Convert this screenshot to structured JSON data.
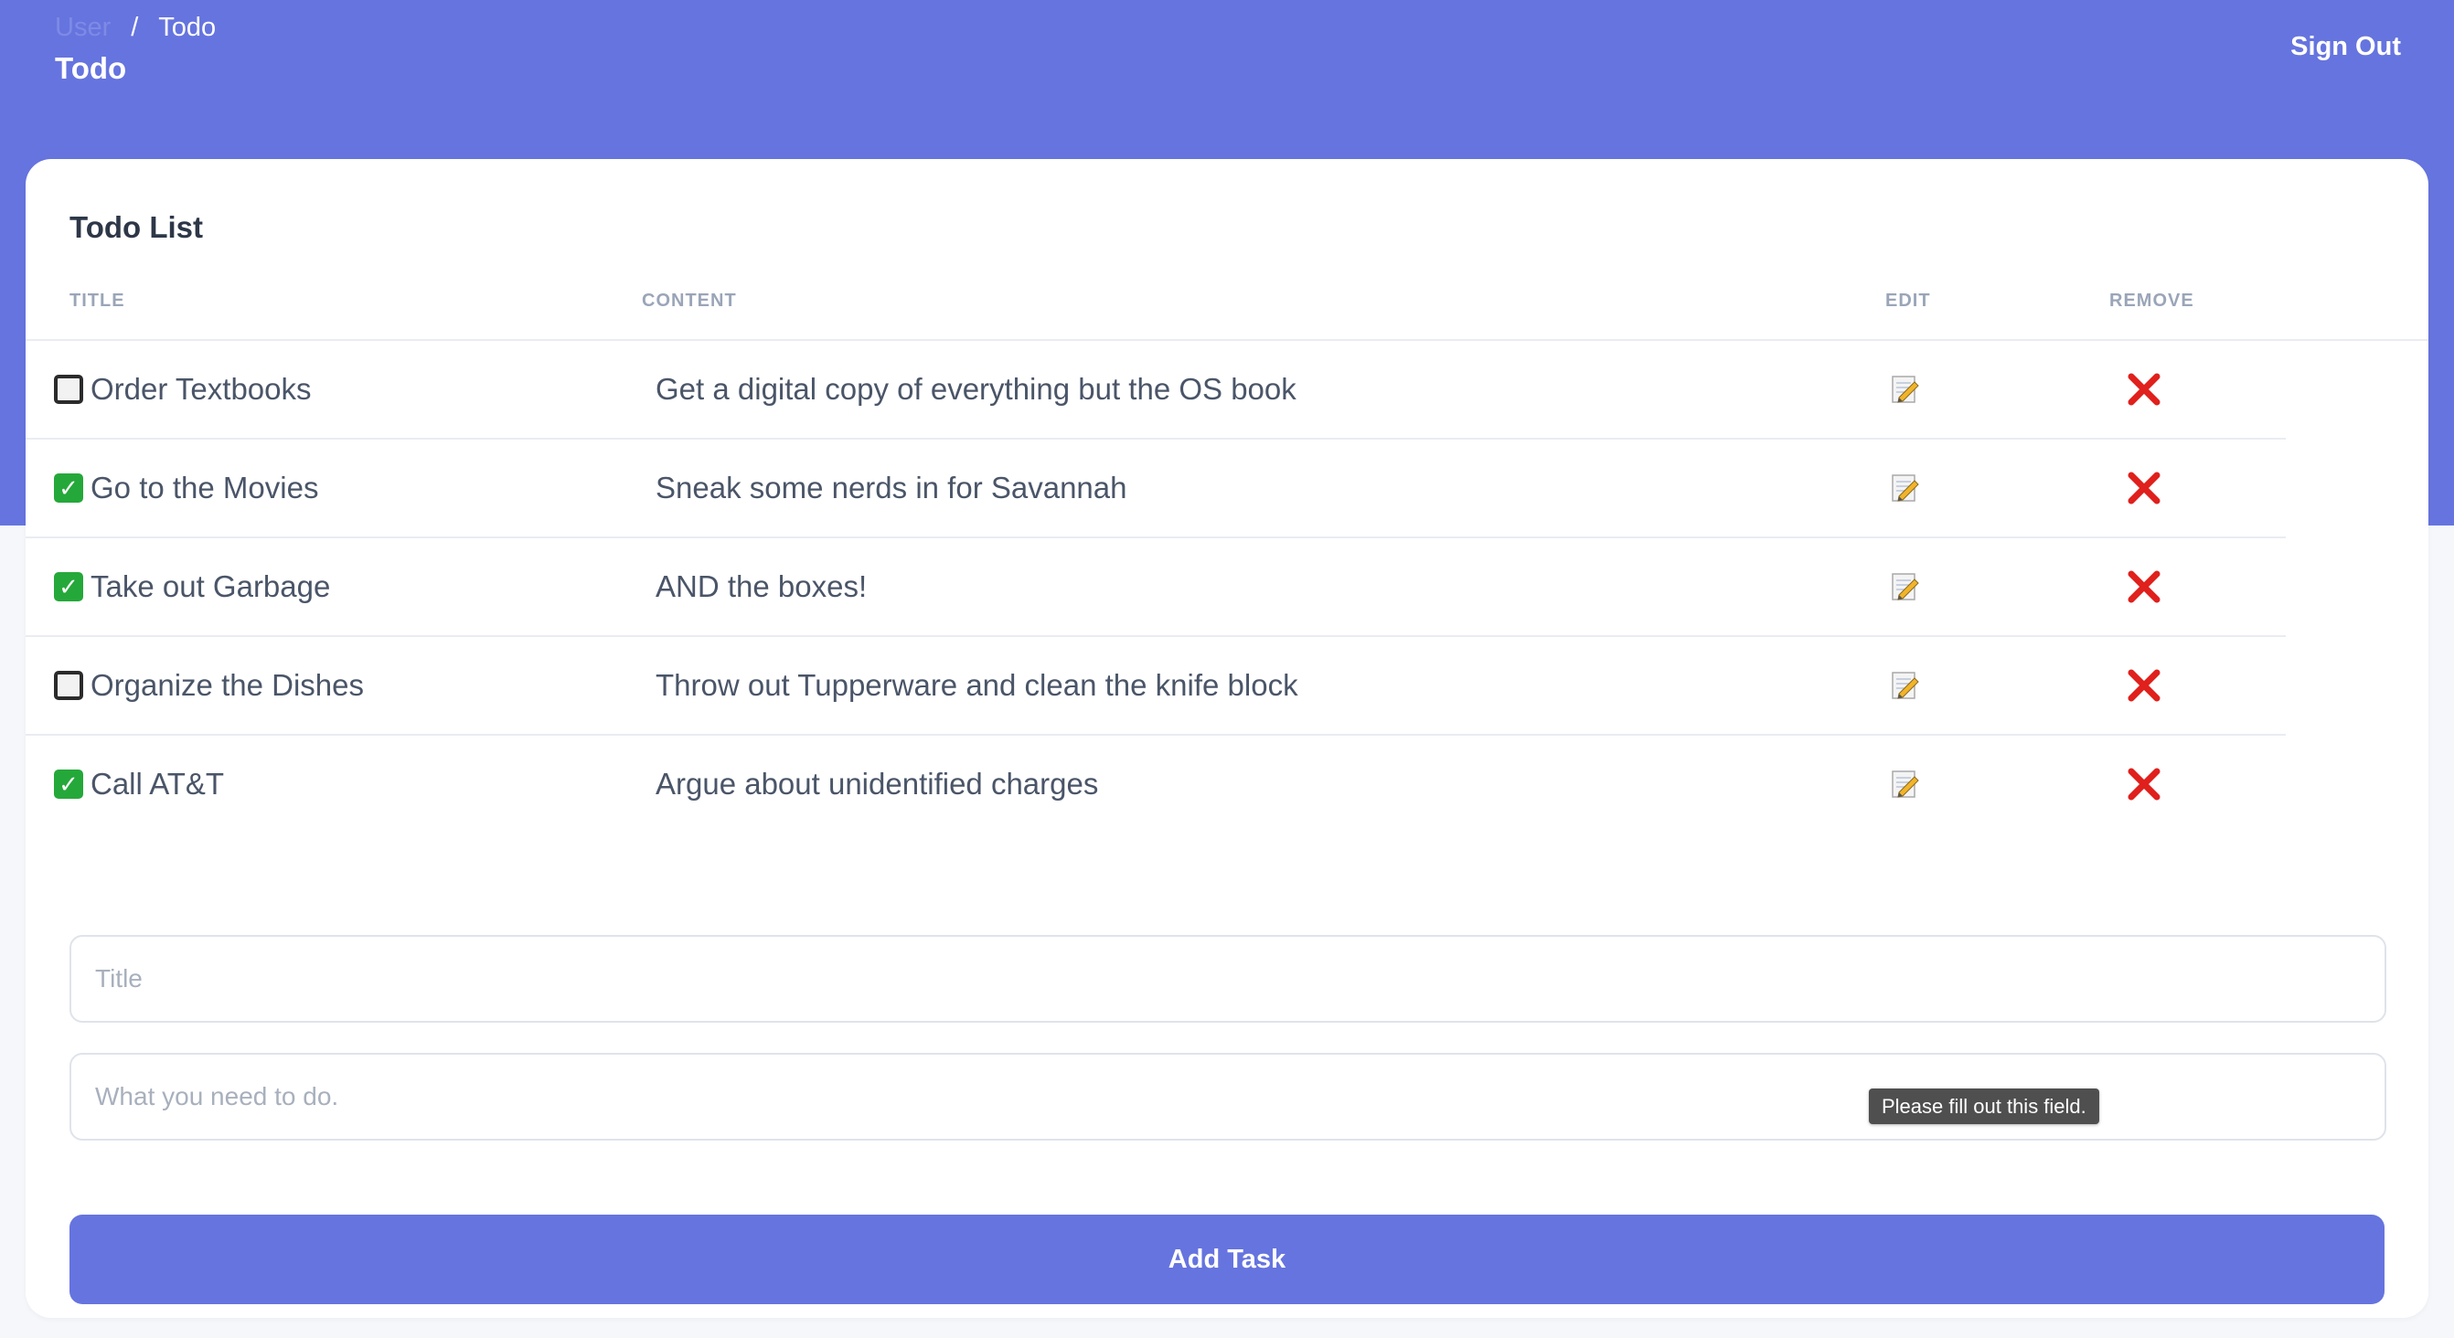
{
  "breadcrumb": {
    "home": "User",
    "separator": "/",
    "current": "Todo"
  },
  "header": {
    "title": "Todo",
    "sign_out": "Sign Out"
  },
  "card": {
    "title": "Todo List"
  },
  "columns": {
    "title": "TITLE",
    "content": "CONTENT",
    "edit": "EDIT",
    "remove": "REMOVE"
  },
  "todos": [
    {
      "title": "Order Textbooks",
      "content": "Get a digital copy of everything but the OS book",
      "done": false
    },
    {
      "title": "Go to the Movies",
      "content": "Sneak some nerds in for Savannah",
      "done": true
    },
    {
      "title": "Take out Garbage",
      "content": "AND the boxes!",
      "done": true
    },
    {
      "title": "Organize the Dishes",
      "content": "Throw out Tupperware and clean the knife block",
      "done": false
    },
    {
      "title": "Call AT&T",
      "content": "Argue about unidentified charges",
      "done": true
    }
  ],
  "form": {
    "title_placeholder": "Title",
    "title_value": "",
    "content_placeholder": "What you need to do.",
    "content_value": "",
    "validation_tooltip": "Please fill out this field.",
    "submit_label": "Add Task"
  },
  "icons": {
    "checked": "check-mark-button-icon",
    "unchecked": "black-square-button-icon",
    "edit": "memo-pencil-icon",
    "remove": "cross-mark-icon"
  },
  "colors": {
    "brand": "#6674df",
    "check_green": "#25a83a",
    "remove_red": "#e0201c"
  }
}
